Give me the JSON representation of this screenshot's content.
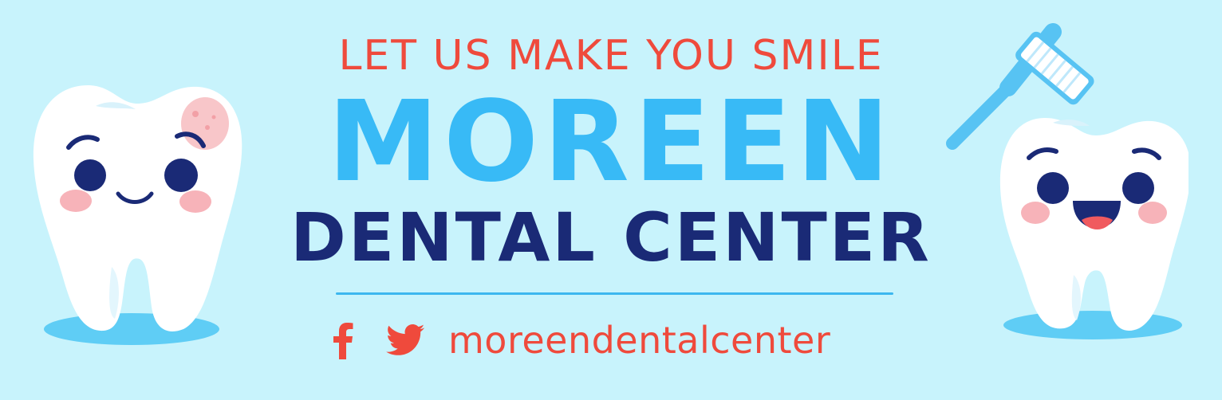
{
  "banner": {
    "tagline": "LET US MAKE YOU SMILE",
    "name": "MOREEN",
    "subtitle": "DENTAL CENTER",
    "social": {
      "icons": [
        "facebook-icon",
        "twitter-icon"
      ],
      "handle": "moreendentalcenter"
    }
  },
  "colors": {
    "background": "#c8f3fc",
    "accent_red": "#ef4a3c",
    "accent_blue": "#38baf6",
    "navy": "#1a2a76",
    "tooth_white": "#ffffff",
    "blush": "#f7b3b9"
  }
}
